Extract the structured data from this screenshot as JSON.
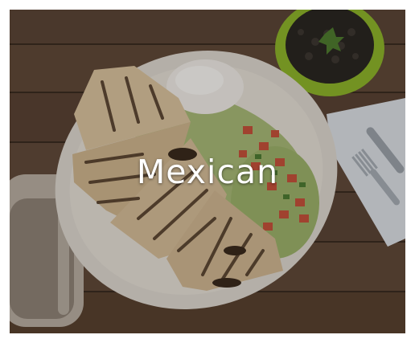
{
  "category_card": {
    "label": "Mexican",
    "image_subject": "quesadilla-plate-photo"
  },
  "colors": {
    "table_wood": "#5a4434",
    "plate": "#e9e4dc",
    "bowl": "#97bf2a",
    "label_text": "#ffffff"
  }
}
